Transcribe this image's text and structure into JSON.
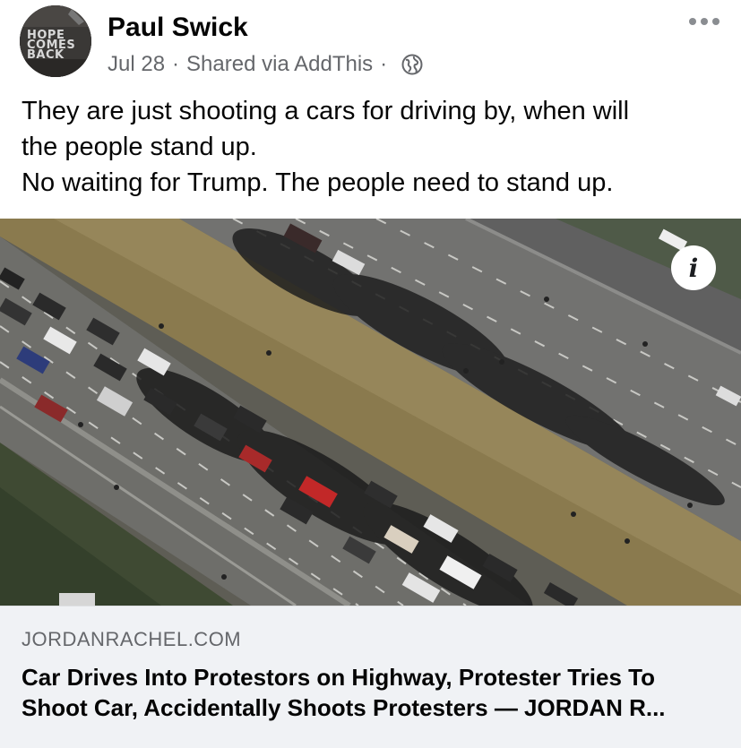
{
  "post": {
    "author": "Paul Swick",
    "avatar_text": [
      "HOPE",
      "COMES",
      "BACK"
    ],
    "date": "Jul 28",
    "separator": "·",
    "shared_via": "Shared via AddThis",
    "audience_icon": "globe-icon",
    "more_icon": "more-options-icon",
    "text_lines": [
      "They are just shooting a cars for driving by, when will",
      "the people stand up.",
      "No waiting for Trump. The people need to stand up."
    ]
  },
  "link": {
    "image_description_icon": "info-icon",
    "info_label": "i",
    "domain": "JORDANRACHEL.COM",
    "title_lines": [
      "Car Drives Into Protestors on Highway, Protester Tries To",
      "Shoot Car, Accidentally Shoots Protesters — JORDAN R..."
    ]
  },
  "colors": {
    "meta_text": "#65676b",
    "footer_bg": "#f0f2f5",
    "text": "#050505"
  }
}
